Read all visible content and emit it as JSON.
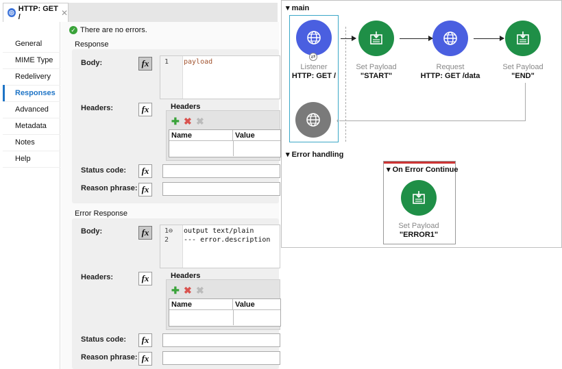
{
  "tab": {
    "title": "HTTP: GET /",
    "close": "✕"
  },
  "sidebar": {
    "items": [
      {
        "label": "General"
      },
      {
        "label": "MIME Type"
      },
      {
        "label": "Redelivery"
      },
      {
        "label": "Responses",
        "active": true
      },
      {
        "label": "Advanced"
      },
      {
        "label": "Metadata"
      },
      {
        "label": "Notes"
      },
      {
        "label": "Help"
      }
    ]
  },
  "status": {
    "message": "There are no errors."
  },
  "response": {
    "title": "Response",
    "body_label": "Body:",
    "body_code": [
      {
        "line": "1",
        "text": "payload"
      }
    ],
    "headers_label": "Headers:",
    "headers_title": "Headers",
    "col_name": "Name",
    "col_value": "Value",
    "status_code_label": "Status code:",
    "reason_label": "Reason phrase:",
    "fx": "fx"
  },
  "error_response": {
    "title": "Error Response",
    "body_label": "Body:",
    "body_code": [
      {
        "line": "1⊖",
        "text": "output text/plain"
      },
      {
        "line": "2",
        "text": "--- error.description"
      }
    ],
    "headers_label": "Headers:",
    "headers_title": "Headers",
    "col_name": "Name",
    "col_value": "Value",
    "status_code_label": "Status code:",
    "reason_label": "Reason phrase:",
    "fx": "fx"
  },
  "toolbar_icons": {
    "add": "✚",
    "remove": "✖",
    "remove_all": "✖"
  },
  "flow": {
    "main_title": "main",
    "nodes": [
      {
        "type": "Listener",
        "name": "HTTP: GET /"
      },
      {
        "type": "Set Payload",
        "name": "\"START\""
      },
      {
        "type": "Request",
        "name": "HTTP: GET /data"
      },
      {
        "type": "Set Payload",
        "name": "\"END\""
      }
    ],
    "error_handling_title": "Error handling",
    "on_error": {
      "title": "On Error Continue",
      "node": {
        "type": "Set Payload",
        "name": "\"ERROR1\""
      }
    }
  },
  "colors": {
    "accent": "#1e74c6",
    "http_node": "#4a5fe0",
    "payload_node": "#1f8f47",
    "ok": "#3aa33a"
  }
}
